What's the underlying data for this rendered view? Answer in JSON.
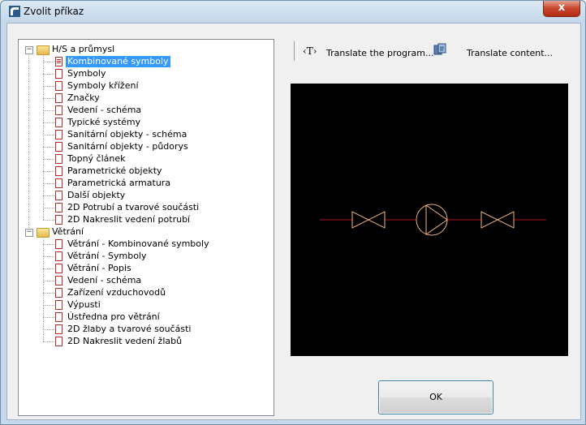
{
  "window": {
    "title": "Zvolit příkaz",
    "close_glyph": "x"
  },
  "tree": {
    "groups": [
      {
        "label": "H/S a průmysl",
        "expander": "−",
        "items": [
          {
            "label": "Kombinované symboly",
            "selected": true
          },
          {
            "label": "Symboly"
          },
          {
            "label": "Symboly křížení"
          },
          {
            "label": "Značky"
          },
          {
            "label": "Vedení - schéma"
          },
          {
            "label": "Typické systémy"
          },
          {
            "label": "Sanitární objekty - schéma"
          },
          {
            "label": "Sanitární objekty - půdorys"
          },
          {
            "label": "Topný článek"
          },
          {
            "label": "Parametrické objekty"
          },
          {
            "label": "Parametrická armatura"
          },
          {
            "label": "Další objekty"
          },
          {
            "label": "2D Potrubí a tvarové součásti"
          },
          {
            "label": "2D Nakreslit vedení potrubí"
          }
        ]
      },
      {
        "label": "Větrání",
        "expander": "−",
        "items": [
          {
            "label": "Větrání - Kombinované symboly"
          },
          {
            "label": "Větrání - Symboly"
          },
          {
            "label": "Větrání - Popis"
          },
          {
            "label": "Vedení - schéma"
          },
          {
            "label": "Zařízení vzduchovodů"
          },
          {
            "label": "Výpusti"
          },
          {
            "label": "Ústředna pro větrání"
          },
          {
            "label": "2D žlaby a tvarové součásti"
          },
          {
            "label": "2D Nakreslit vedení žlabů"
          }
        ]
      }
    ]
  },
  "toolbar": {
    "translate_program_icon": "‹T›",
    "translate_program_label": "Translate the program...",
    "translate_content_label": "Translate content..."
  },
  "preview": {
    "background": "#000000",
    "pipe_color": "#b8102a",
    "symbol_color": "#f0b37a"
  },
  "buttons": {
    "ok_label": "OK"
  }
}
